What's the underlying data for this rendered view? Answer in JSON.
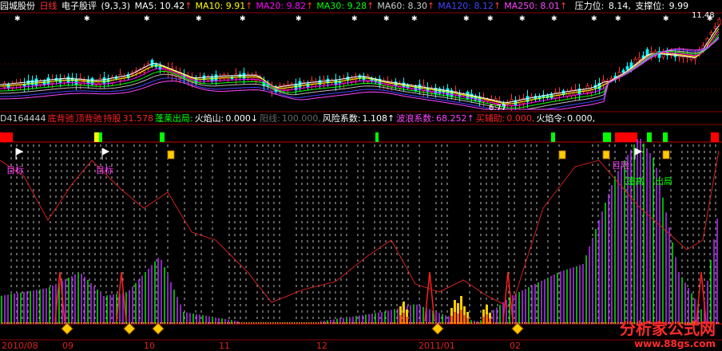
{
  "header": {
    "stock_name": "园城股份",
    "period": "日线",
    "indicator": "电子股评",
    "params": "(9,3,3)",
    "ma": [
      {
        "label": "MA5:",
        "value": "10.42",
        "color": "#ffffff",
        "arrow": "↑"
      },
      {
        "label": "MA10:",
        "value": "9.91",
        "color": "#ffff00",
        "arrow": "↑"
      },
      {
        "label": "MA20:",
        "value": "9.82",
        "color": "#ff00ff",
        "arrow": "↑"
      },
      {
        "label": "MA30:",
        "value": "9.28",
        "color": "#00ff00",
        "arrow": "↑"
      },
      {
        "label": "MA60:",
        "value": "8.30",
        "color": "#cccccc",
        "arrow": "↑"
      },
      {
        "label": "MA120:",
        "value": "8.12",
        "color": "#4444ff",
        "arrow": "↑"
      },
      {
        "label": "MA250:",
        "value": "8.01",
        "color": "#ff44ff",
        "arrow": "↑"
      }
    ],
    "pressure_label": "压力位:",
    "pressure_value": "8.14,",
    "support_label": "支撑位:",
    "support_value": "9.99"
  },
  "price_labels": {
    "high": "11.48",
    "low": "6.77"
  },
  "indicator_header": [
    {
      "text": "D4164444",
      "color": "#cccccc"
    },
    {
      "text": "底背驰",
      "color": "#ff2020"
    },
    {
      "text": "顶背驰",
      "color": "#ff2020"
    },
    {
      "text": "持股",
      "color": "#ff2020"
    },
    {
      "text": "31.578",
      "color": "#ff2020"
    },
    {
      "text": "蓬莱出局:",
      "color": "#00ff00"
    },
    {
      "text": "火焰山:",
      "color": "#ffffff"
    },
    {
      "text": "0.000↓",
      "color": "#ffffff"
    },
    {
      "text": "阳线:",
      "color": "#666666"
    },
    {
      "text": "100.000,",
      "color": "#666666"
    },
    {
      "text": "风险系数:",
      "color": "#ffffff"
    },
    {
      "text": "1.108↑",
      "color": "#ffffff"
    },
    {
      "text": "波浪系数:",
      "color": "#ff44ff"
    },
    {
      "text": "68.252↑",
      "color": "#ff44ff"
    },
    {
      "text": "买辅助:",
      "color": "#ff2020"
    },
    {
      "text": "0.000,",
      "color": "#ff2020"
    },
    {
      "text": "火焰令:",
      "color": "#ffffff"
    },
    {
      "text": "0.000,",
      "color": "#ffffff"
    }
  ],
  "signals": [
    {
      "text": "目标",
      "color": "#ff44ff"
    },
    {
      "text": "目标",
      "color": "#ff44ff"
    },
    {
      "text": "目险",
      "color": "#ff44ff"
    },
    {
      "text": "蓬高",
      "color": "#00ff00"
    },
    {
      "text": "出局",
      "color": "#00ff00"
    }
  ],
  "x_axis": [
    "2010/08",
    "09",
    "10",
    "11",
    "12",
    "2011/01",
    "02"
  ],
  "watermark": {
    "name": "分析家公式网",
    "url": "www.88gs.com"
  },
  "chart_data": {
    "type": "candlestick",
    "x_ticks": [
      "2010/08",
      "09",
      "10",
      "11",
      "12",
      "2011/01",
      "02"
    ],
    "price_high": 11.48,
    "price_low": 6.77,
    "moving_averages": [
      "MA5",
      "MA10",
      "MA20",
      "MA30",
      "MA60",
      "MA120",
      "MA250"
    ]
  },
  "colors": {
    "background": "#000000",
    "grid": "#8b0000",
    "up": "#ff3030",
    "down": "#00ffff",
    "indicator_line": "#d02020"
  }
}
